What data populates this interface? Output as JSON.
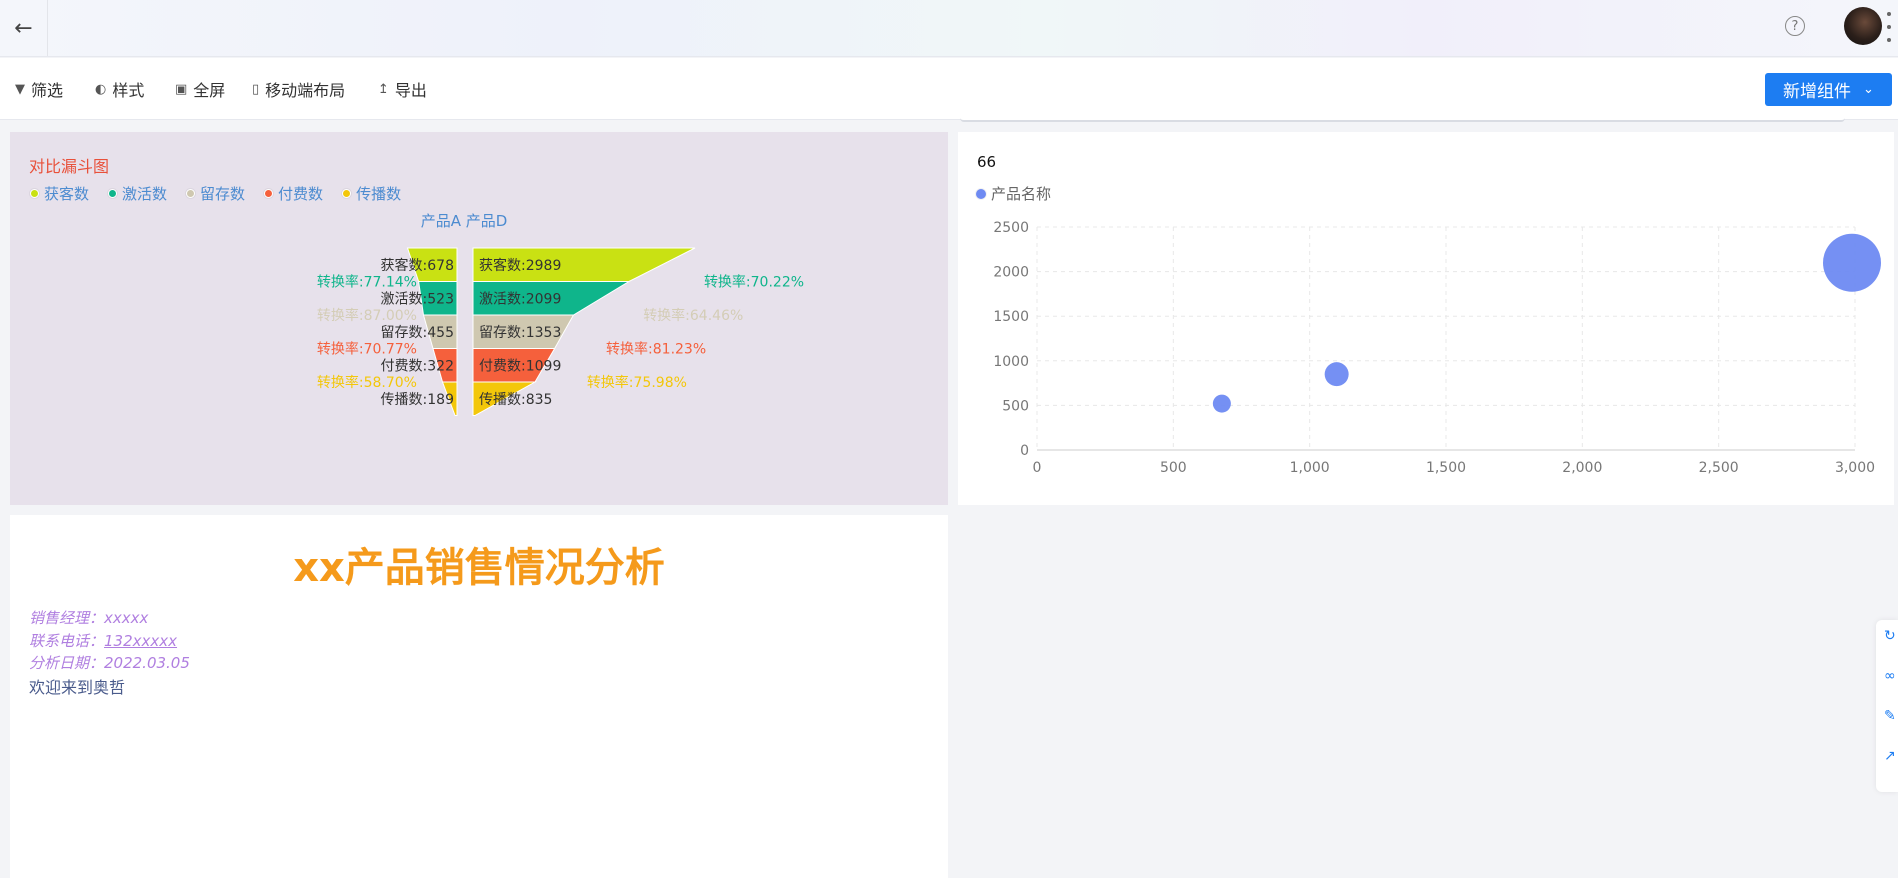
{
  "header": {
    "back_icon": "arrow-left-icon",
    "help_icon": "question-circle-icon"
  },
  "toolbar": {
    "items": [
      {
        "label": "筛选",
        "icon": "filter-icon"
      },
      {
        "label": "样式",
        "icon": "palette-icon"
      },
      {
        "label": "全屏",
        "icon": "fullscreen-icon"
      },
      {
        "label": "移动端布局",
        "icon": "mobile-icon"
      },
      {
        "label": "导出",
        "icon": "upload-icon"
      }
    ],
    "add_button": "新增组件"
  },
  "funnel_panel": {
    "title": "对比漏斗图",
    "legend": [
      {
        "name": "获客数",
        "color": "#c9e113"
      },
      {
        "name": "激活数",
        "color": "#0fb58b"
      },
      {
        "name": "留存数",
        "color": "#cfc8b0"
      },
      {
        "name": "付费数",
        "color": "#f5603c"
      },
      {
        "name": "传播数",
        "color": "#f3c70a"
      }
    ],
    "subtitle": "产品A  产品D"
  },
  "chart_data": [
    {
      "type": "funnel",
      "title": "对比漏斗图",
      "subtitle": "产品A  产品D",
      "stages": [
        "获客数",
        "激活数",
        "留存数",
        "付费数",
        "传播数"
      ],
      "colors": [
        "#c9e113",
        "#0fb58b",
        "#cfc8b0",
        "#f5603c",
        "#f3c70a"
      ],
      "series": [
        {
          "name": "产品A",
          "values": [
            678,
            523,
            455,
            322,
            189
          ],
          "rates": [
            "77.14%",
            "87.00%",
            "70.77%",
            "58.70%"
          ]
        },
        {
          "name": "产品D",
          "values": [
            2989,
            2099,
            1353,
            1099,
            835
          ],
          "rates": [
            "70.22%",
            "64.46%",
            "81.23%",
            "75.98%"
          ]
        }
      ],
      "label_prefix": "转换率:"
    },
    {
      "type": "scatter",
      "title": "66",
      "series": [
        {
          "name": "产品名称",
          "color": "#6e8af2",
          "points": [
            {
              "x": 678,
              "y": 520,
              "size": 9
            },
            {
              "x": 1099,
              "y": 850,
              "size": 12
            },
            {
              "x": 2989,
              "y": 2099,
              "size": 29
            }
          ]
        }
      ],
      "xlim": [
        0,
        3000
      ],
      "ylim": [
        0,
        2500
      ],
      "xticks": [
        "0",
        "500",
        "1,000",
        "1,500",
        "2,000",
        "2,500",
        "3,000"
      ],
      "yticks": [
        "0",
        "500",
        "1000",
        "1500",
        "2000",
        "2500"
      ],
      "grid": true
    }
  ],
  "scatter_panel": {
    "title": "66",
    "legend": "产品名称"
  },
  "text_panel": {
    "heading": "xx产品销售情况分析",
    "manager": "销售经理：xxxxx",
    "phone_label": "联系电话：",
    "phone": "132xxxxx",
    "date": "分析日期：2022.03.05",
    "welcome": "欢迎来到奥哲"
  }
}
